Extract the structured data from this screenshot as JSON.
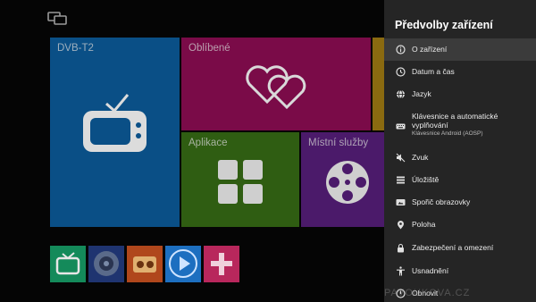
{
  "tiles": {
    "dvb": "DVB-T2",
    "favorites": "Oblíbené",
    "apps": "Aplikace",
    "local": "Místní služby"
  },
  "dock": [
    "tv-icon",
    "speaker-icon",
    "media-icon",
    "play-icon",
    "plus-icon"
  ],
  "panel": {
    "title": "Předvolby zařízení",
    "items": [
      {
        "label": "O zařízení",
        "icon": "info-icon"
      },
      {
        "label": "Datum a čas",
        "icon": "clock-icon"
      },
      {
        "label": "Jazyk",
        "icon": "globe-icon"
      },
      {
        "label": "Klávesnice a automatické vyplňování",
        "sub": "Klávesnice Android (AOSP)",
        "icon": "keyboard-icon"
      },
      {
        "label": "Zvuk",
        "icon": "mute-icon"
      },
      {
        "label": "Úložiště",
        "icon": "storage-icon"
      },
      {
        "label": "Spořič obrazovky",
        "icon": "screensaver-icon"
      },
      {
        "label": "Poloha",
        "icon": "location-icon"
      },
      {
        "label": "Zabezpečení a omezení",
        "icon": "lock-icon"
      },
      {
        "label": "Usnadnění",
        "icon": "accessibility-icon"
      },
      {
        "label": "Obnovit",
        "icon": "reset-icon"
      }
    ]
  },
  "watermark": "PAVOUKOVA.CZ",
  "colors": {
    "panel": "#252525",
    "dvb": "#0a4f86",
    "favorites": "#7a0b48",
    "apps": "#2f5d12",
    "local": "#4b1a6a"
  }
}
